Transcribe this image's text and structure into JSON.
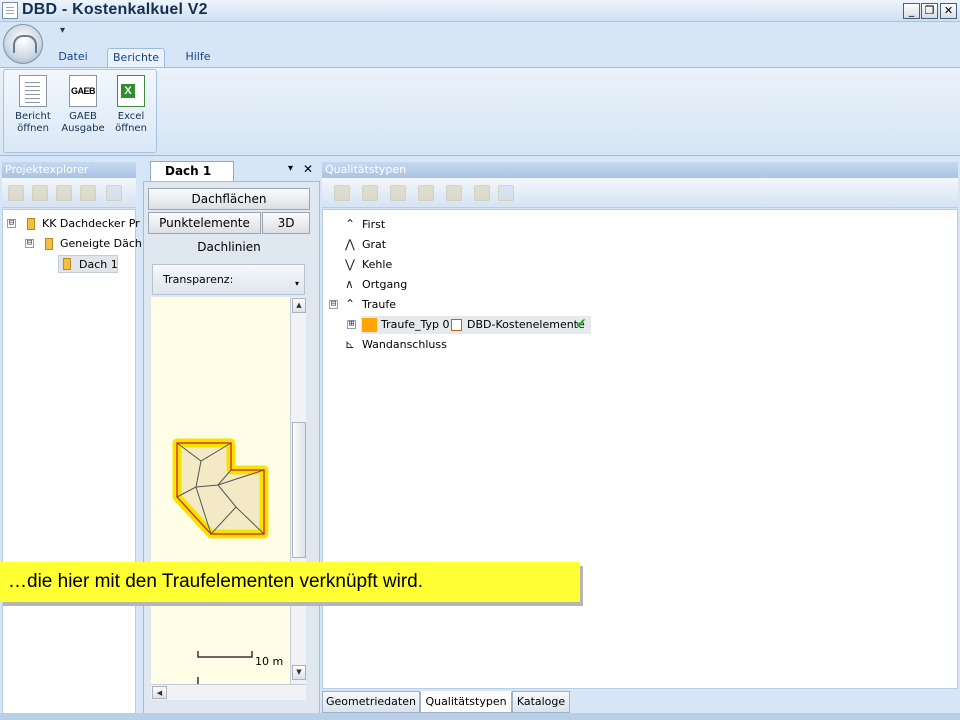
{
  "window": {
    "title": "DBD - Kostenkalkuel V2",
    "minimize": "_",
    "restore": "❐",
    "close": "✕"
  },
  "ribbon": {
    "qat_dropdown": "▾",
    "tabs": [
      "Datei",
      "Berichte",
      "Hilfe"
    ],
    "active_tab": "Berichte",
    "buttons": [
      {
        "label": "Bericht\nöffnen",
        "icon": "report-icon",
        "glyph": ""
      },
      {
        "label": "GAEB\nAusgabe",
        "icon": "gaeb-icon",
        "glyph": "GAEB"
      },
      {
        "label": "Excel\nöffnen",
        "icon": "excel-icon",
        "glyph": ""
      }
    ]
  },
  "projektexplorer": {
    "title": "Projektexplorer",
    "tree": [
      {
        "label": "KK Dachdecker Pr",
        "expander": "⊟"
      },
      {
        "label": "Geneigte Däch",
        "expander": "⊟"
      },
      {
        "label": "Dach 1",
        "expander": ""
      }
    ]
  },
  "dach_panel": {
    "tab": "Dach 1",
    "pin": "▾",
    "close": "✕",
    "buttons": {
      "dachflaechen": "Dachflächen",
      "punktelemente": "Punktelemente",
      "3d": "3D",
      "dachlinien": "Dachlinien"
    },
    "transparenz_label": "Transparenz:",
    "scale_label": "10 m",
    "scroll_up": "▲",
    "scroll_down": "▼",
    "scroll_left": "◀"
  },
  "qualitaetstypen": {
    "title": "Qualitätstypen",
    "items": [
      {
        "label": "First",
        "icon": "first-icon",
        "glyph": "⌃"
      },
      {
        "label": "Grat",
        "icon": "grat-icon",
        "glyph": "⋀"
      },
      {
        "label": "Kehle",
        "icon": "kehle-icon",
        "glyph": "⋁"
      },
      {
        "label": "Ortgang",
        "icon": "ortgang-icon",
        "glyph": "∧"
      },
      {
        "label": "Traufe",
        "icon": "traufe-icon",
        "glyph": "⌃",
        "expander": "⊟"
      },
      {
        "label": "Wandanschluss",
        "icon": "wandanschluss-icon",
        "glyph": "⊾"
      }
    ],
    "child": {
      "label": "Traufe_Typ 0",
      "link": "DBD-Kostenelemente",
      "expander": "⊞",
      "check": "✔"
    },
    "bottom_tabs": [
      "Geometriedaten",
      "Qualitätstypen",
      "Kataloge"
    ],
    "active_bottom_tab": "Qualitätstypen"
  },
  "tooltip": {
    "text": "…die hier mit den Traufelementen verknüpft wird."
  },
  "colors": {
    "accent": "#15428b",
    "highlight": "#ffff33",
    "roof_outline": "#f0e000",
    "orange": "#ffa500"
  }
}
